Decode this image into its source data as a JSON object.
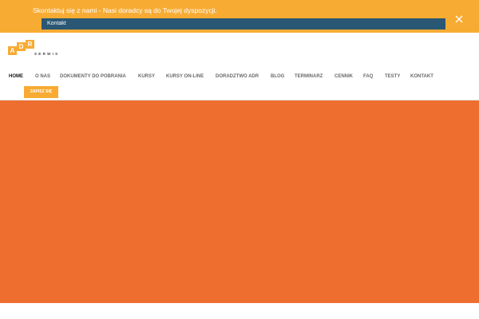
{
  "notice": {
    "text": "Skontaktuj się z nami - Nasi doradcy są do Twojej dyspozycji.",
    "button_label": "Kontakt",
    "close_icon": "close-icon",
    "color": "#f8ab33"
  },
  "logo": {
    "letters": [
      "A",
      "D",
      "R"
    ],
    "subtitle": "SERWIS",
    "color": "#f8ab33"
  },
  "nav": {
    "items": [
      {
        "label": "HOME",
        "active": true
      },
      {
        "label": "O NAS",
        "active": false
      },
      {
        "label": "DOKUMENTY DO POBRANIA",
        "active": false
      },
      {
        "label": "KURSY",
        "active": false
      },
      {
        "label": "KURSY ON-LINE",
        "active": false
      },
      {
        "label": "DORADZTWO ADR",
        "active": false
      },
      {
        "label": "BLOG",
        "active": false
      },
      {
        "label": "TERMINARZ",
        "active": false
      },
      {
        "label": "CENNIK",
        "active": false
      },
      {
        "label": "FAQ",
        "active": false
      },
      {
        "label": "TESTY",
        "active": false
      },
      {
        "label": "KONTAKT",
        "active": false
      }
    ],
    "signup_label": "ZAPISZ SIĘ"
  },
  "hero": {
    "color": "#ee6e30"
  }
}
